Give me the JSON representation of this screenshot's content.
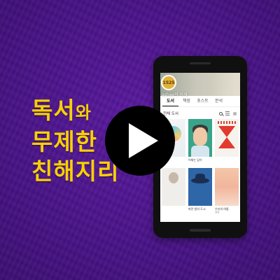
{
  "headline": {
    "line1_main": "독서",
    "line1_small": "와",
    "line2": "무제한",
    "line3": "친해지리"
  },
  "app": {
    "profile": {
      "avatar_text": "1525",
      "owner_name": "ashee의 서재"
    },
    "tabs": [
      {
        "label": "도서",
        "active": true
      },
      {
        "label": "책장",
        "active": false
      },
      {
        "label": "포스트",
        "active": false
      },
      {
        "label": "문석",
        "active": false
      }
    ],
    "section_title": "전체 도서",
    "books": [
      {
        "title": "",
        "author": ""
      },
      {
        "title": "이제는 답이",
        "author": ""
      },
      {
        "title": "",
        "author": ""
      },
      {
        "title": "",
        "author": ""
      },
      {
        "title": "파란 밤의 도시",
        "author": ""
      },
      {
        "title": "우리의 여름",
        "author": "김은"
      }
    ]
  },
  "icons": {
    "play": "play-icon",
    "search": "search-icon",
    "list": "list-icon",
    "grid": "grid-icon"
  },
  "colors": {
    "background": "#4a1489",
    "headline": "#f8d000",
    "play_button": "#000000"
  }
}
